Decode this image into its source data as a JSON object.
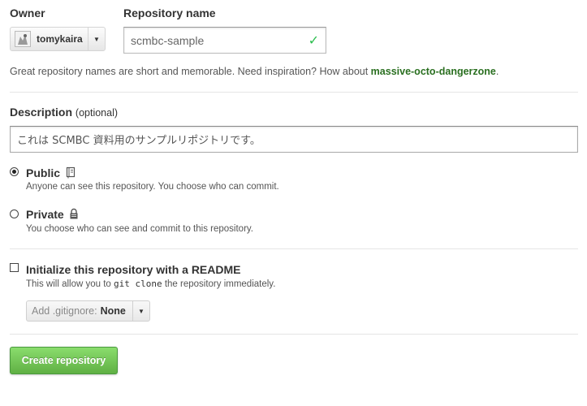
{
  "owner": {
    "label": "Owner",
    "name": "tomykaira"
  },
  "repository": {
    "label": "Repository name",
    "value": "scmbc-sample"
  },
  "hint": {
    "text": "Great repository names are short and memorable. Need inspiration? How about ",
    "suggestion": "massive-octo-dangerzone",
    "end": "."
  },
  "description": {
    "label": "Description",
    "optional": "(optional)",
    "value": "これは SCMBC 資料用のサンプルリポジトリです。"
  },
  "visibility": {
    "public": {
      "title": "Public",
      "desc": "Anyone can see this repository. You choose who can commit.",
      "checked": true
    },
    "private": {
      "title": "Private",
      "desc": "You choose who can see and commit to this repository.",
      "checked": false
    }
  },
  "readme": {
    "title": "Initialize this repository with a README",
    "desc_before": "This will allow you to ",
    "desc_code": "git clone",
    "desc_after": " the repository immediately."
  },
  "gitignore": {
    "label": "Add .gitignore:",
    "value": "None"
  },
  "create_button": "Create repository",
  "colors": {
    "suggestion": "#2a6f20",
    "check": "#2cbe4e",
    "button_green": "#60b044"
  }
}
